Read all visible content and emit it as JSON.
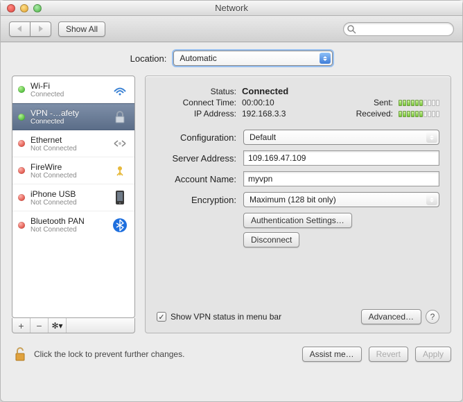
{
  "window": {
    "title": "Network"
  },
  "toolbar": {
    "show_all": "Show All"
  },
  "location": {
    "label": "Location:",
    "value": "Automatic"
  },
  "sidebar": {
    "items": [
      {
        "name": "Wi-Fi",
        "sub": "Connected",
        "status": "green",
        "icon": "wifi"
      },
      {
        "name": "VPN -…afety",
        "sub": "Connected",
        "status": "green",
        "icon": "lock",
        "selected": true
      },
      {
        "name": "Ethernet",
        "sub": "Not Connected",
        "status": "red",
        "icon": "ethernet"
      },
      {
        "name": "FireWire",
        "sub": "Not Connected",
        "status": "red",
        "icon": "firewire"
      },
      {
        "name": "iPhone USB",
        "sub": "Not Connected",
        "status": "red",
        "icon": "usb"
      },
      {
        "name": "Bluetooth PAN",
        "sub": "Not Connected",
        "status": "red",
        "icon": "bluetooth"
      }
    ]
  },
  "detail": {
    "status_label": "Status:",
    "status_value": "Connected",
    "connect_time_label": "Connect Time:",
    "connect_time_value": "00:00:10",
    "ip_label": "IP Address:",
    "ip_value": "192.168.3.3",
    "sent_label": "Sent:",
    "received_label": "Received:",
    "sent_bars": 6,
    "received_bars": 6,
    "bars_total": 10,
    "config_label": "Configuration:",
    "config_value": "Default",
    "server_label": "Server Address:",
    "server_value": "109.169.47.109",
    "account_label": "Account Name:",
    "account_value": "myvpn",
    "encryption_label": "Encryption:",
    "encryption_value": "Maximum (128 bit only)",
    "auth_button": "Authentication Settings…",
    "disconnect_button": "Disconnect",
    "show_menu_bar": "Show VPN status in menu bar",
    "advanced_button": "Advanced…"
  },
  "bottom": {
    "lock_text": "Click the lock to prevent further changes.",
    "assist": "Assist me…",
    "revert": "Revert",
    "apply": "Apply"
  }
}
